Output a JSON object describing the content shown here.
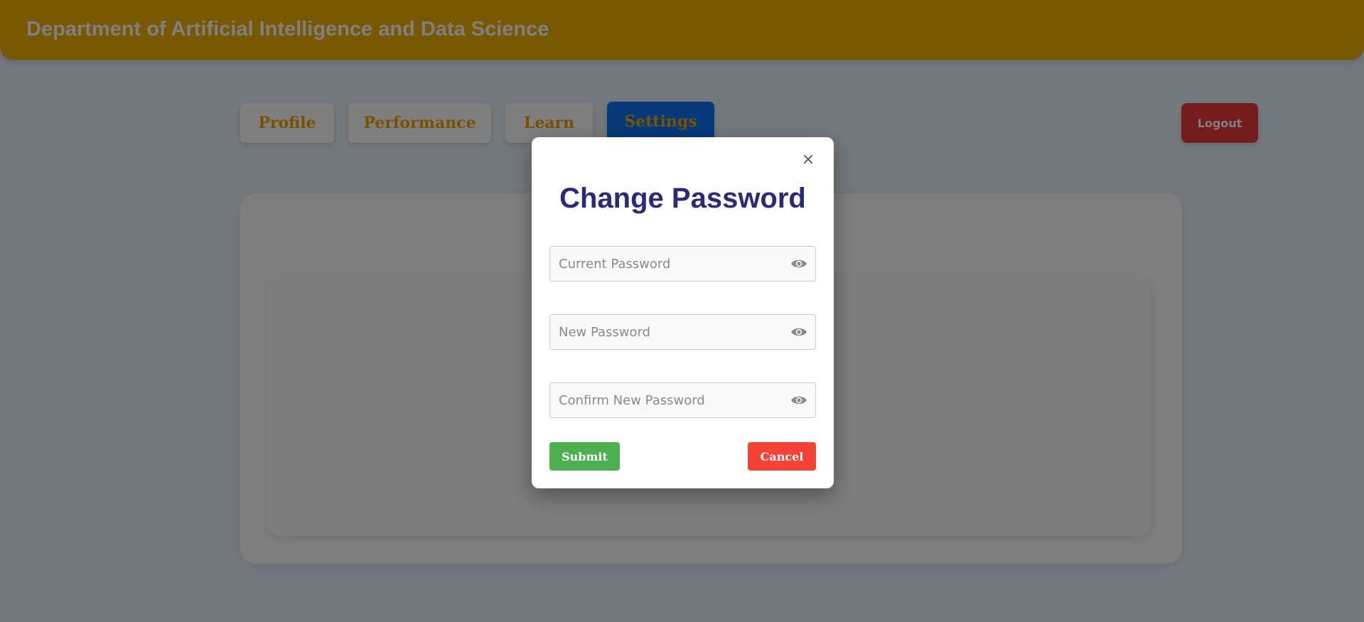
{
  "header": {
    "title": "Department of Artificial Intelligence and Data Science"
  },
  "nav": {
    "tabs": [
      {
        "label": "Profile",
        "active": false
      },
      {
        "label": "Performance",
        "active": false
      },
      {
        "label": "Learn",
        "active": false
      },
      {
        "label": "Settings",
        "active": true
      }
    ],
    "logout_label": "Logout"
  },
  "modal": {
    "title": "Change Password",
    "close_glyph": "×",
    "fields": [
      {
        "placeholder": "Current Password",
        "value": "",
        "icon": "eye-icon"
      },
      {
        "placeholder": "New Password",
        "value": "",
        "icon": "eye-icon"
      },
      {
        "placeholder": "Confirm New Password",
        "value": "",
        "icon": "eye-icon"
      }
    ],
    "submit_label": "Submit",
    "cancel_label": "Cancel"
  },
  "colors": {
    "header_bg": "#f0b000",
    "tab_text": "#f0a500",
    "active_tab_bg": "#0d74f5",
    "logout_bg": "#ea3b3b",
    "modal_title": "#2b2a7a",
    "submit_bg": "#4caf50",
    "cancel_bg": "#f44336",
    "overlay": "rgba(0,0,0,0.5)"
  }
}
